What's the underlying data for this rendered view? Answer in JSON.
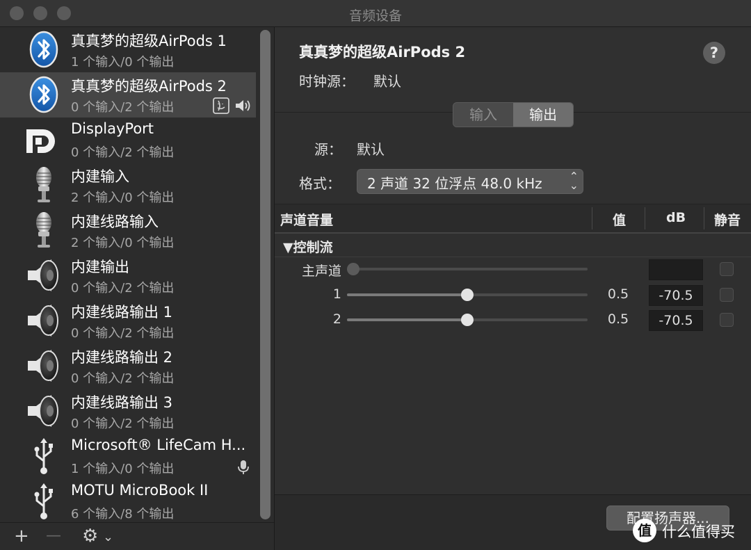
{
  "window": {
    "title": "音频设备",
    "traffic_lights": [
      "close",
      "minimize",
      "zoom"
    ]
  },
  "sidebar": {
    "devices": [
      {
        "name": "真真梦的超级AirPods 1",
        "io": "1 个输入/0 个输出",
        "icon": "bluetooth-icon"
      },
      {
        "name": "真真梦的超级AirPods 2",
        "io": "0 个输入/2 个输出",
        "icon": "bluetooth-icon",
        "selected": true,
        "badges": [
          "finder-icon",
          "speaker-icon"
        ]
      },
      {
        "name": "DisplayPort",
        "io": "0 个输入/2 个输出",
        "icon": "displayport-icon"
      },
      {
        "name": "内建输入",
        "io": "2 个输入/0 个输出",
        "icon": "microphone-icon"
      },
      {
        "name": "内建线路输入",
        "io": "2 个输入/0 个输出",
        "icon": "microphone-icon"
      },
      {
        "name": "内建输出",
        "io": "0 个输入/2 个输出",
        "icon": "speaker-icon"
      },
      {
        "name": "内建线路输出 1",
        "io": "0 个输入/2 个输出",
        "icon": "speaker-icon"
      },
      {
        "name": "内建线路输出 2",
        "io": "0 个输入/2 个输出",
        "icon": "speaker-icon"
      },
      {
        "name": "内建线路输出 3",
        "io": "0 个输入/2 个输出",
        "icon": "speaker-icon"
      },
      {
        "name": "Microsoft® LifeCam H...",
        "io": "1 个输入/0 个输出",
        "icon": "usb-icon",
        "badges": [
          "mic-icon"
        ]
      },
      {
        "name": "MOTU MicroBook II",
        "io": "6 个输入/8 个输出",
        "icon": "usb-icon"
      }
    ],
    "bottom": {
      "add": "+",
      "remove": "—",
      "gear": "⚙",
      "gear_caret": "⌄"
    }
  },
  "detail": {
    "device_title": "真真梦的超级AirPods 2",
    "clock_label": "时钟源：",
    "clock_value": "默认",
    "help": "?",
    "tabs": {
      "input": "输入",
      "output": "输出",
      "selected": "output"
    },
    "source_label": "源：",
    "source_value": "默认",
    "format_label": "格式：",
    "format_value": "2 声道 32 位浮点 48.0 kHz",
    "table": {
      "headers": {
        "channel_volume": "声道音量",
        "value": "值",
        "db": "dB",
        "mute": "静音"
      },
      "group": "▼控制流",
      "rows": [
        {
          "label": "主声道",
          "slider": 0.0,
          "enabled": false,
          "value": "",
          "db": "",
          "muted": false
        },
        {
          "label": "1",
          "slider": 0.5,
          "enabled": true,
          "value": "0.5",
          "db": "-70.5",
          "muted": false
        },
        {
          "label": "2",
          "slider": 0.5,
          "enabled": true,
          "value": "0.5",
          "db": "-70.5",
          "muted": false
        }
      ]
    },
    "configure_speakers": "配置扬声器..."
  },
  "watermark": {
    "logo": "值",
    "text": "什么值得买"
  }
}
